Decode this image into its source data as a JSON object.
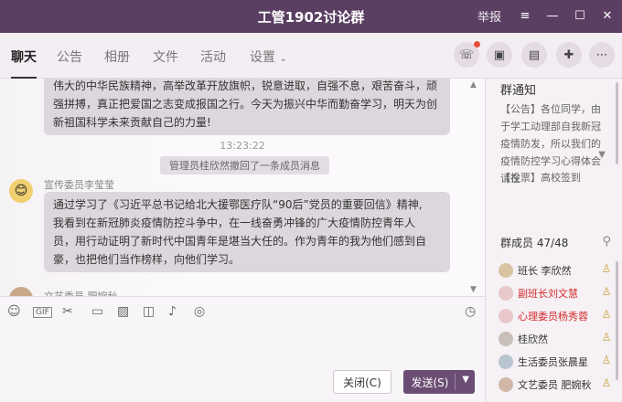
{
  "window": {
    "title": "工管1902讨论群",
    "report_label": "举报",
    "controls": [
      "≡",
      "—",
      "☐",
      "✕"
    ]
  },
  "tabs": [
    {
      "label": "聊天",
      "active": true
    },
    {
      "label": "公告"
    },
    {
      "label": "相册"
    },
    {
      "label": "文件"
    },
    {
      "label": "活动"
    },
    {
      "label": "设置"
    }
  ],
  "toolbar_icons": [
    "phone-icon",
    "video-icon",
    "screen-share-icon",
    "add-message-icon",
    "more-icon"
  ],
  "chat": {
    "message1_lines": [
      "伟大的中华民族精神，高举改革开放旗帜，锐意进取，自强不息，艰苦奋斗，顽",
      "强拼搏，真正把爱国之志变成报国之行。今天为振兴中华而勤奋学习，明天为创",
      "新祖国科学未来贡献自己的力量!"
    ],
    "time": "13:23:22",
    "system_msg": "管理员桂欣然撤回了一条成员消息",
    "sender2": "宣传委员李莹莹",
    "message2_lines": [
      "通过学习了《习近平总书记给北大援鄂医疗队“90后”党员的重要回信》精神,",
      "我看到在新冠肺炎疫情防控斗争中，在一线奋勇冲锋的广大疫情防控青年人",
      "员，用行动证明了新时代中国青年是堪当大任的。作为青年的我为他们感到自",
      "豪，也把他们当作榜样，向他们学习。"
    ],
    "sender3": "文艺委员 肥婉秋"
  },
  "input_tools": [
    "smiley-icon",
    "gif-icon",
    "scissors-icon",
    "folder-icon",
    "image-icon",
    "screenshot-icon",
    "bell-icon",
    "voice-icon",
    "history-icon"
  ],
  "buttons": {
    "close": "关闭(C)",
    "send": "发送(S)"
  },
  "notice": {
    "title": "群通知",
    "body": "【公告】各位同学，由于学工动理部自我新冠疫情防发，所以我们的疫情防控学习心得体会请在",
    "link": "【投票】高校签到"
  },
  "members": {
    "header": "群成员 47/48",
    "list": [
      {
        "name": "班长 李欣然",
        "red": false
      },
      {
        "name": "副班长刘文慧",
        "red": true
      },
      {
        "name": "心理委员杨秀蓉",
        "red": true
      },
      {
        "name": "桂欣然",
        "red": false
      },
      {
        "name": "生活委员张晨星",
        "red": false
      },
      {
        "name": "文艺委员 肥婉秋",
        "red": false
      }
    ]
  }
}
